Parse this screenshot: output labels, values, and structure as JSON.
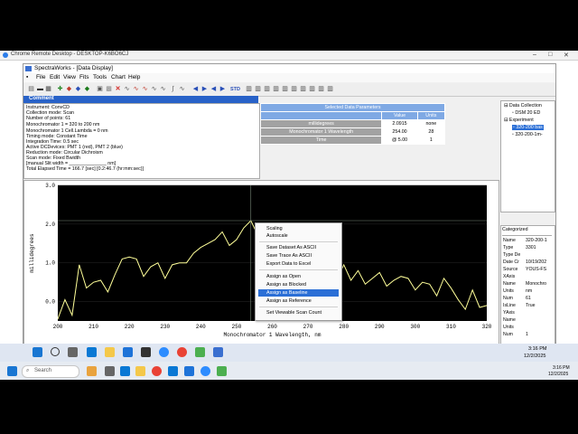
{
  "remote_desktop": {
    "title": "Chrome Remote Desktop - DESKTOP-K6BO6CJ"
  },
  "app": {
    "title": "SpectraWorks - [Data Display]",
    "menu": [
      "File",
      "Edit",
      "View",
      "Fits",
      "Tools",
      "Chart",
      "Help"
    ],
    "toolbar_std_label": "STD"
  },
  "comment": {
    "header": "Comment",
    "lines": [
      "Instrument: ConvCD",
      "Collection mode: Scan",
      "Number of points: 61",
      "     Monochromator 1 = 320 to 200 nm",
      "     Monochromator 1 Cell.Lambda = 0 nm",
      "Timing mode: Constant Time",
      "Integration Time: 0.5 sec",
      "Active DCDevices: PMT 1 (red), PMT 2 (blue)",
      "Reduction mode: Circular Dichroism",
      "Scan mode: Fixed Bwidth",
      "   [manual Slit width = ______________ nm]",
      "Total Elapsed Time = 166.7  [sec]   [0.2:46.7  (hr:mm:sec)]"
    ]
  },
  "params": {
    "title": "Selected Data Parameters",
    "columns": [
      "",
      "Value",
      "Units"
    ],
    "rows": [
      {
        "label": "millidegrees",
        "value": "2.0915",
        "units": "none"
      },
      {
        "label": "Monochromator 1 Wavelength",
        "value": "254.00",
        "units": "28"
      },
      {
        "label": "Time",
        "value": "@ 5.00",
        "units": "1"
      }
    ]
  },
  "tree": {
    "items": [
      {
        "label": "Data Collection"
      },
      {
        "label": "DSM 20 ED"
      },
      {
        "label": "Experiment"
      },
      {
        "label": "320-200 bas",
        "selected": true
      },
      {
        "label": "320-200-1m-"
      }
    ]
  },
  "categorized": {
    "header": "Categorized",
    "rows": [
      {
        "k": "Name",
        "v": "320-200-1"
      },
      {
        "k": "Type",
        "v": "3301"
      },
      {
        "k": "Type De",
        "v": ""
      },
      {
        "k": "Date Cr",
        "v": "10/19/202"
      },
      {
        "k": "Source",
        "v": "YOUS-FS"
      },
      {
        "k": "XAxis",
        "v": ""
      },
      {
        "k": "Name",
        "v": "Monochro"
      },
      {
        "k": "Units",
        "v": "nm"
      },
      {
        "k": "Num",
        "v": "61"
      },
      {
        "k": "IsLine",
        "v": "True"
      },
      {
        "k": "YAxis",
        "v": ""
      },
      {
        "k": "Name",
        "v": ""
      },
      {
        "k": "Units",
        "v": ""
      },
      {
        "k": "Num",
        "v": "1"
      },
      {
        "k": "IsLine",
        "v": ""
      }
    ]
  },
  "chart_data": {
    "type": "line",
    "xlabel": "Monochromator 1 Wavelength, nm",
    "ylabel": "millidegrees",
    "xlim": [
      200,
      320
    ],
    "ylim": [
      -0.5,
      3.0
    ],
    "xticks": [
      "200",
      "210",
      "220",
      "230",
      "240",
      "250",
      "260",
      "270",
      "280",
      "290",
      "300",
      "310",
      "320"
    ],
    "yticks": [
      "3.0",
      "2.0",
      "1.0",
      "0.0"
    ],
    "ytick_values": [
      3.0,
      2.0,
      1.0,
      0.0
    ],
    "line_color": "#ffff99",
    "background": "#000000",
    "cursor": {
      "x": 254,
      "y": 2.09
    },
    "series": [
      {
        "x": [
          200,
          202,
          204,
          206,
          208,
          210,
          212,
          214,
          216,
          218,
          220,
          222,
          224,
          226,
          228,
          230,
          232,
          234,
          236,
          238,
          240,
          242,
          244,
          246,
          248,
          250,
          252,
          254,
          256,
          258,
          260,
          262,
          264,
          266,
          268,
          270,
          272,
          274,
          276,
          278,
          280,
          282,
          284,
          286,
          288,
          290,
          292,
          294,
          296,
          298,
          300,
          302,
          304,
          306,
          308,
          310,
          312,
          314,
          316,
          318,
          320
        ],
        "y": [
          -0.45,
          0.05,
          -0.35,
          0.95,
          0.35,
          0.5,
          0.55,
          0.25,
          0.7,
          1.1,
          1.15,
          1.1,
          0.65,
          0.9,
          1.0,
          0.6,
          0.95,
          1.0,
          1.0,
          1.25,
          1.4,
          1.5,
          1.6,
          1.8,
          1.45,
          1.6,
          1.9,
          2.09,
          1.7,
          1.45,
          1.15,
          1.05,
          1.0,
          0.7,
          0.55,
          0.6,
          0.75,
          0.8,
          0.75,
          0.55,
          0.95,
          0.55,
          0.8,
          0.45,
          0.6,
          0.75,
          0.4,
          0.55,
          0.65,
          0.6,
          0.3,
          0.5,
          0.45,
          0.15,
          0.6,
          0.35,
          0.05,
          -0.2,
          0.3,
          -0.15,
          -0.1
        ]
      }
    ]
  },
  "context_menu": {
    "items": [
      "Scaling",
      "Autoscale",
      "Save Dataset As ASCII",
      "Save Trace As ASCII",
      "Export Data to Excel",
      "Assign as Open",
      "Assign as Blocked",
      "Assign as Baseline",
      "Assign as Reference",
      "Set Viewable Scan Count"
    ],
    "selected": "Assign as Baseline"
  },
  "taskbar": {
    "time": "3:16 PM",
    "date": "12/2/2025",
    "search_placeholder": "Search"
  }
}
